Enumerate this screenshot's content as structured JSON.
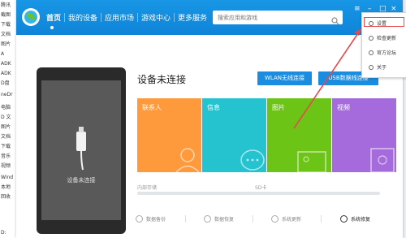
{
  "left_strip": [
    "腾讯",
    "截图",
    "下载",
    "文档",
    "图片",
    "A",
    "ADK",
    "ADK",
    "D盘",
    "neDr",
    "电脑",
    "D 文",
    "图片",
    "文档",
    "下载",
    "音乐",
    "视频",
    "Wind",
    "本地",
    "回收",
    "D:"
  ],
  "nav": {
    "items": [
      "首页",
      "我的设备",
      "应用市场",
      "游戏中心",
      "更多服务"
    ],
    "search_placeholder": "搜索应用和游戏"
  },
  "window_controls": {
    "menu": "≡",
    "minimize": "–",
    "restore": "□",
    "close": "×"
  },
  "device": {
    "status_title": "设备未连接",
    "phone_label": "设备未连接",
    "wlan_button": "WLAN无线连接",
    "usb_button": "USB数据线连接"
  },
  "tiles": [
    {
      "label": "联系人",
      "color": "#ff9a3c"
    },
    {
      "label": "信息",
      "color": "#25c3cf"
    },
    {
      "label": "图片",
      "color": "#6cc417"
    },
    {
      "label": "视频",
      "color": "#a56bdd"
    }
  ],
  "storage": {
    "internal": "内部存储",
    "sd": "SD卡"
  },
  "tools": [
    "数据备份",
    "数据恢复",
    "系统更新",
    "系统修复"
  ],
  "menu": {
    "items": [
      "设置",
      "检查更新",
      "官方论坛",
      "关于"
    ]
  },
  "colors": {
    "topbar": "#1190e0",
    "accent": "#1a8de0",
    "annotation": "#e64a4a"
  }
}
